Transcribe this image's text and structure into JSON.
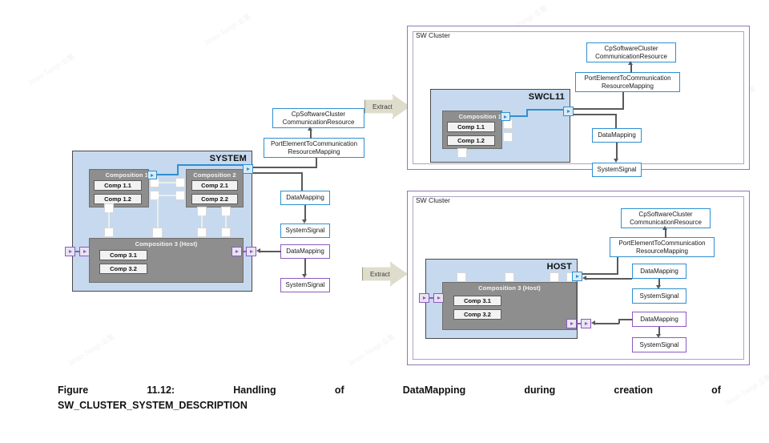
{
  "figure": {
    "caption_words": [
      "Figure",
      "11.12:",
      "Handling",
      "of",
      "DataMapping",
      "during",
      "creation",
      "of"
    ],
    "caption_line2": "SW_CLUSTER_SYSTEM_DESCRIPTION"
  },
  "colors": {
    "system_fill": "#c6d9ee",
    "composition_fill": "#8e8e8e",
    "blue_accent": "#2f8fd0",
    "purple_accent": "#8c5bc0",
    "extract_fill": "#dedccb",
    "line_gray": "#5a5a5a"
  },
  "system": {
    "title": "SYSTEM",
    "compositions": [
      {
        "name": "Composition 1",
        "components": [
          "Comp 1.1",
          "Comp 1.2"
        ]
      },
      {
        "name": "Composition 2",
        "components": [
          "Comp 2.1",
          "Comp 2.2"
        ]
      },
      {
        "name": "Composition 3 (Host)",
        "components": [
          "Comp 3.1",
          "Comp 3.2"
        ]
      }
    ]
  },
  "middle_column": {
    "blue_chain": [
      "CpSoftwareCluster\nCommunicationResource",
      "PortElementToCommunication\nResourceMapping",
      "DataMapping",
      "SystemSignal"
    ],
    "purple_chain": [
      "DataMapping",
      "SystemSignal"
    ],
    "cp_line1": "CpSoftwareCluster",
    "cp_line2": "CommunicationResource",
    "pe_line1": "PortElementToCommunication",
    "pe_line2": "ResourceMapping",
    "datamapping": "DataMapping",
    "systemsignal": "SystemSignal"
  },
  "extract_arrows": [
    {
      "label": "Extract"
    },
    {
      "label": "Extract"
    }
  ],
  "cluster_top": {
    "frame_label": "SW Cluster",
    "box_title": "SWCL11",
    "composition": {
      "name": "Composition 1",
      "components": [
        "Comp 1.1",
        "Comp 1.2"
      ]
    },
    "cp_line1": "CpSoftwareCluster",
    "cp_line2": "CommunicationResource",
    "pe_line1": "PortElementToCommunication",
    "pe_line2": "ResourceMapping",
    "datamapping": "DataMapping",
    "systemsignal": "SystemSignal"
  },
  "cluster_bottom": {
    "frame_label": "SW Cluster",
    "box_title": "HOST",
    "composition": {
      "name": "Composition 3 (Host)",
      "components": [
        "Comp 3.1",
        "Comp 3.2"
      ]
    },
    "cp_line1": "CpSoftwareCluster",
    "cp_line2": "CommunicationResource",
    "pe_line1": "PortElementToCommunication",
    "pe_line2": "ResourceMapping",
    "datamapping_blue": "DataMapping",
    "systemsignal_blue": "SystemSignal",
    "datamapping_purple": "DataMapping",
    "systemsignal_purple": "SystemSignal"
  }
}
